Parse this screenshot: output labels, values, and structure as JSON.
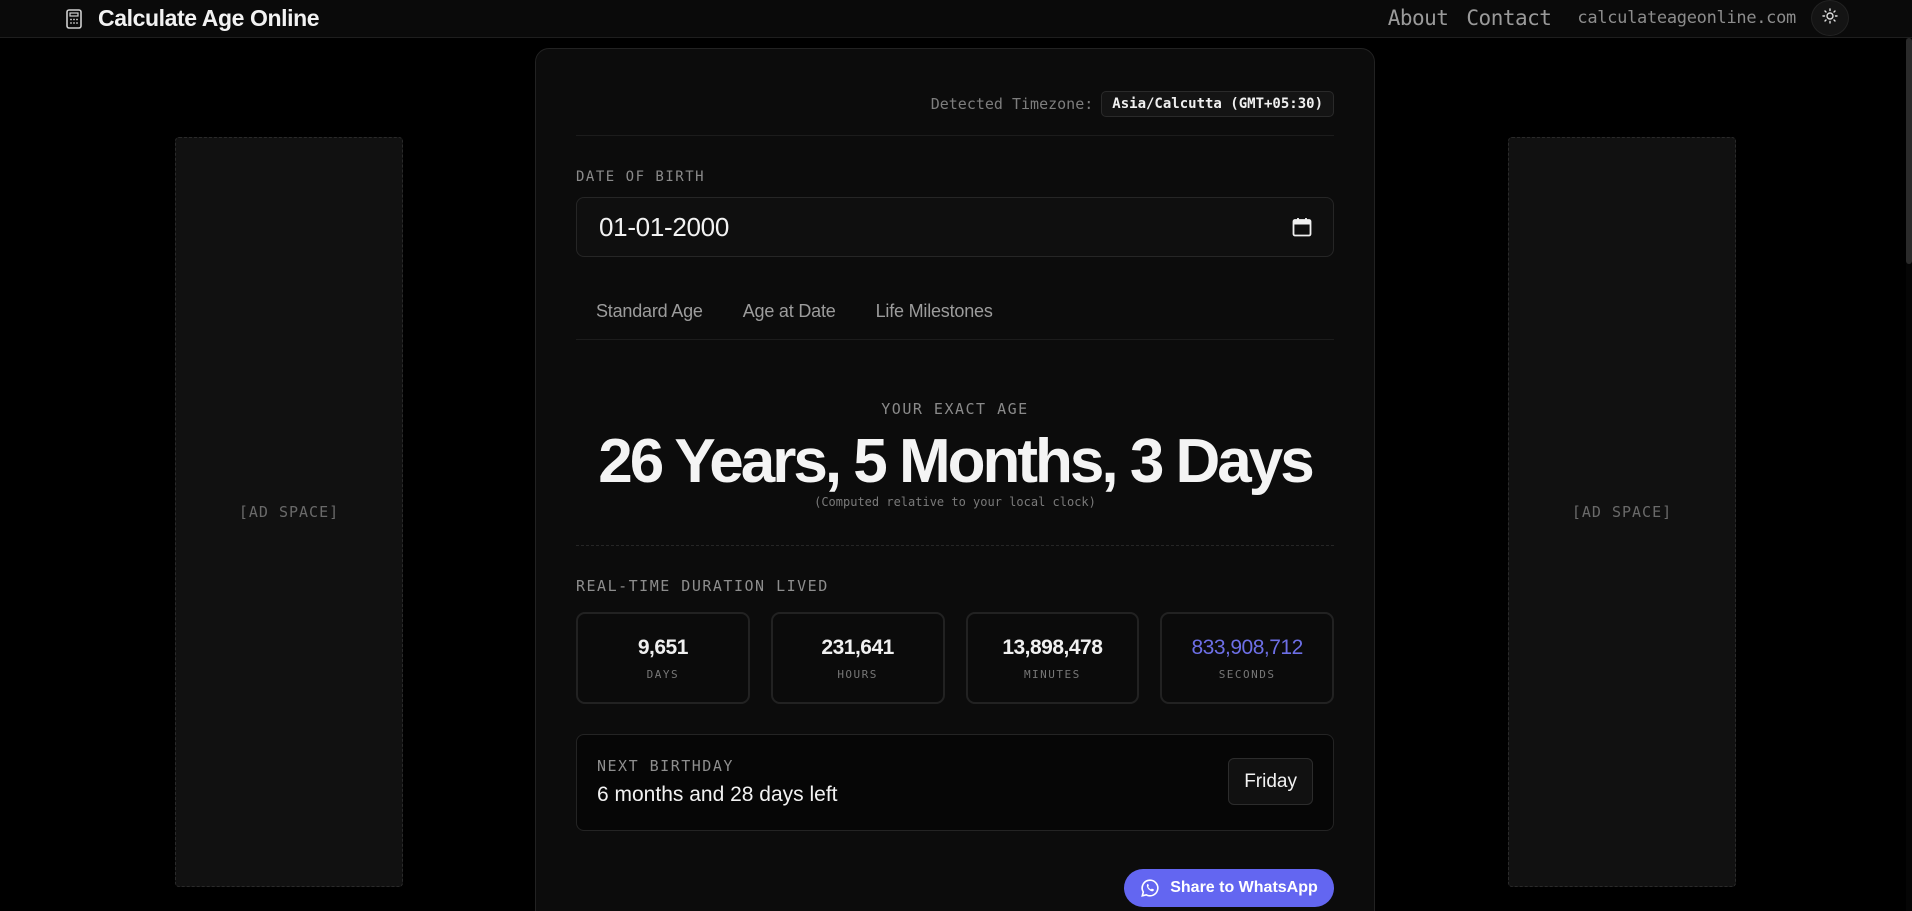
{
  "header": {
    "title": "Calculate Age Online",
    "icon": "calculator-icon",
    "nav": [
      {
        "label": "About"
      },
      {
        "label": "Contact"
      }
    ],
    "domain": "calculateageonline.com",
    "theme_icon": "sun-icon"
  },
  "ads": {
    "left": "[AD SPACE]",
    "right": "[AD SPACE]"
  },
  "timezone": {
    "label": "Detected Timezone:",
    "value": "Asia/Calcutta (GMT+05:30)"
  },
  "dob": {
    "label": "DATE OF BIRTH",
    "value": "01-01-2000",
    "icon": "calendar-icon"
  },
  "tabs": [
    {
      "label": "Standard Age"
    },
    {
      "label": "Age at Date"
    },
    {
      "label": "Life Milestones"
    }
  ],
  "age": {
    "label": "YOUR EXACT AGE",
    "value": "26 Years, 5 Months, 3 Days",
    "note": "(Computed relative to your local clock)"
  },
  "realtime": {
    "label": "REAL-TIME DURATION LIVED",
    "stats": [
      {
        "value": "9,651",
        "label": "DAYS"
      },
      {
        "value": "231,641",
        "label": "HOURS"
      },
      {
        "value": "13,898,478",
        "label": "MINUTES"
      },
      {
        "value": "833,908,712",
        "label": "SECONDS"
      }
    ]
  },
  "next_birthday": {
    "label": "NEXT BIRTHDAY",
    "value": "6 months and 28 days left",
    "day": "Friday"
  },
  "share": {
    "label": "Share to WhatsApp",
    "icon": "whatsapp-icon"
  },
  "colors": {
    "accent": "#6366f1",
    "seconds_text": "#6d6fe6",
    "background": "#000000",
    "card": "#0c0c0c"
  }
}
